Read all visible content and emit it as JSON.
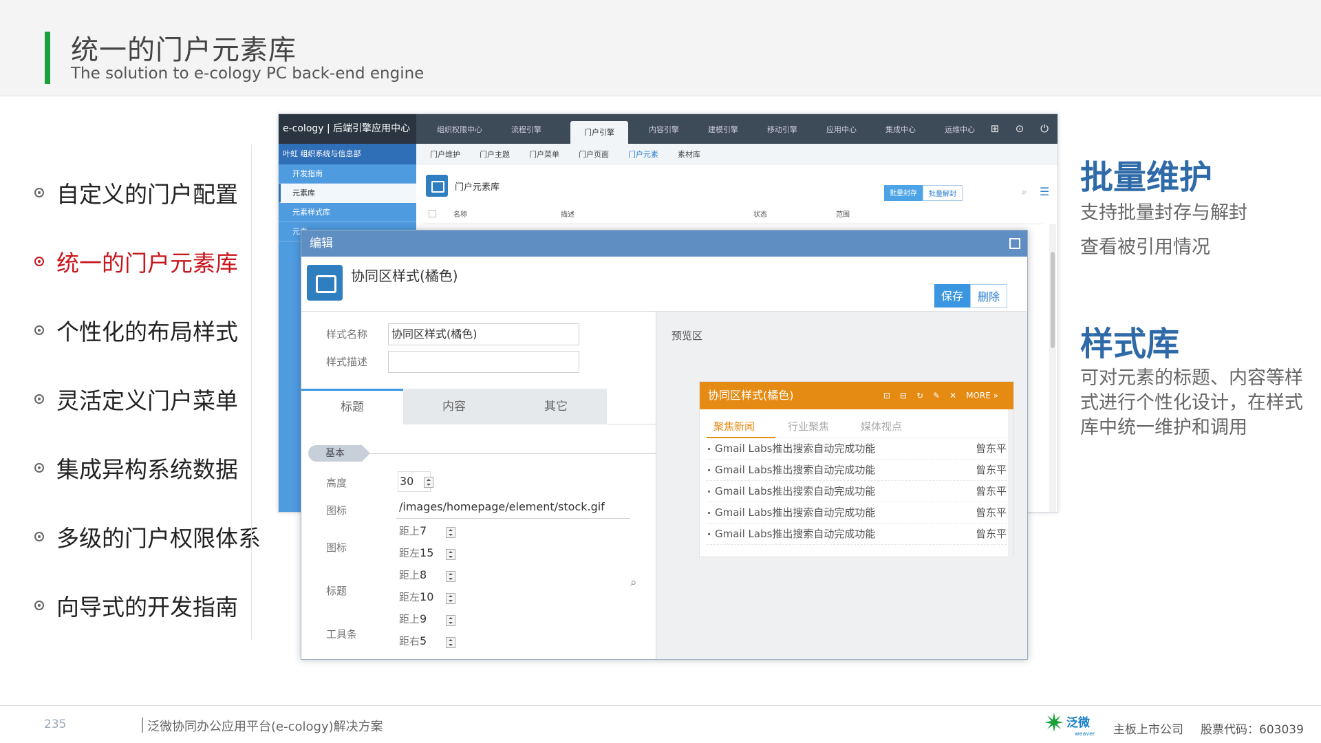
{
  "header": {
    "title": "统一的门户元素库",
    "subtitle": "The solution to e-cology PC back-end engine"
  },
  "features": [
    {
      "label": "自定义的门户配置",
      "active": false
    },
    {
      "label": "统一的门户元素库",
      "active": true
    },
    {
      "label": "个性化的布局样式",
      "active": false
    },
    {
      "label": "灵活定义门户菜单",
      "active": false
    },
    {
      "label": "集成异构系统数据",
      "active": false
    },
    {
      "label": "多级的门户权限体系",
      "active": false
    },
    {
      "label": "向导式的开发指南",
      "active": false
    }
  ],
  "right_panel": {
    "heading1": "批量维护",
    "line1": "支持批量封存与解封",
    "line2": "查看被引用情况",
    "heading2": "样式库",
    "desc": "可对元素的标题、内容等样式进行个性化设计，在样式库中统一维护和调用"
  },
  "back_window": {
    "brand": "e-cology | 后端引擎应用中心",
    "nav": [
      "组织权限中心",
      "流程引擎",
      "门户引擎",
      "内容引擎",
      "建模引擎",
      "移动引擎",
      "应用中心",
      "集成中心",
      "运维中心"
    ],
    "nav_active": "门户引擎",
    "subnav": [
      "门户维护",
      "门户主题",
      "门户菜单",
      "门户页面",
      "门户元素",
      "素材库"
    ],
    "subnav_active": "门户元素",
    "sidebar_top": "叶虹    组织系统与信息部",
    "sidebar": [
      "开发指南",
      "元素库",
      "元素样式库",
      "元素..."
    ],
    "sidebar_active": "元素库",
    "page_title": "门户元素库",
    "btn_seal": "批量封存",
    "btn_unseal": "批量解封",
    "columns": [
      "名称",
      "描述",
      "状态",
      "范围"
    ]
  },
  "dialog": {
    "title": "编辑",
    "style_title": "协同区样式(橘色)",
    "save": "保存",
    "delete": "删除",
    "label_name": "样式名称",
    "value_name": "协同区样式(橘色)",
    "label_desc": "样式描述",
    "value_desc": "",
    "tabs": [
      "标题",
      "内容",
      "其它"
    ],
    "section": "基本",
    "label_height": "高度",
    "value_height": "30",
    "label_icon": "图标",
    "value_icon": "/images/homepage/element/stock.gif",
    "label_icon2": "图标",
    "label_title": "标题",
    "label_toolbar": "工具条",
    "margins": [
      {
        "prefix": "距上",
        "value": "7"
      },
      {
        "prefix": "距左",
        "value": "15"
      },
      {
        "prefix": "距上",
        "value": "8"
      },
      {
        "prefix": "距左",
        "value": "10"
      },
      {
        "prefix": "距上",
        "value": "9"
      },
      {
        "prefix": "距右",
        "value": "5"
      }
    ],
    "preview_label": "预览区",
    "portal": {
      "title": "协同区样式(橘色)",
      "more": "MORE »",
      "tabs": [
        "聚焦新闻",
        "行业聚焦",
        "媒体视点"
      ],
      "rows": [
        {
          "text": "Gmail Labs推出搜索自动完成功能",
          "author": "曾东平"
        },
        {
          "text": "Gmail Labs推出搜索自动完成功能",
          "author": "曾东平"
        },
        {
          "text": "Gmail Labs推出搜索自动完成功能",
          "author": "曾东平"
        },
        {
          "text": "Gmail Labs推出搜索自动完成功能",
          "author": "曾东平"
        },
        {
          "text": "Gmail Labs推出搜索自动完成功能",
          "author": "曾东平"
        }
      ]
    }
  },
  "footer": {
    "page": "235",
    "text": "泛微协同办公应用平台(e-cology)解决方案",
    "logo": "泛微",
    "logo_sub": "weaver",
    "company": "主板上市公司",
    "stock": "股票代码：603039"
  },
  "colors": {
    "accent_green": "#1aa03a",
    "active_red": "#c8161d",
    "heading_blue": "#2f6aa8",
    "portal_orange": "#e58a12"
  }
}
